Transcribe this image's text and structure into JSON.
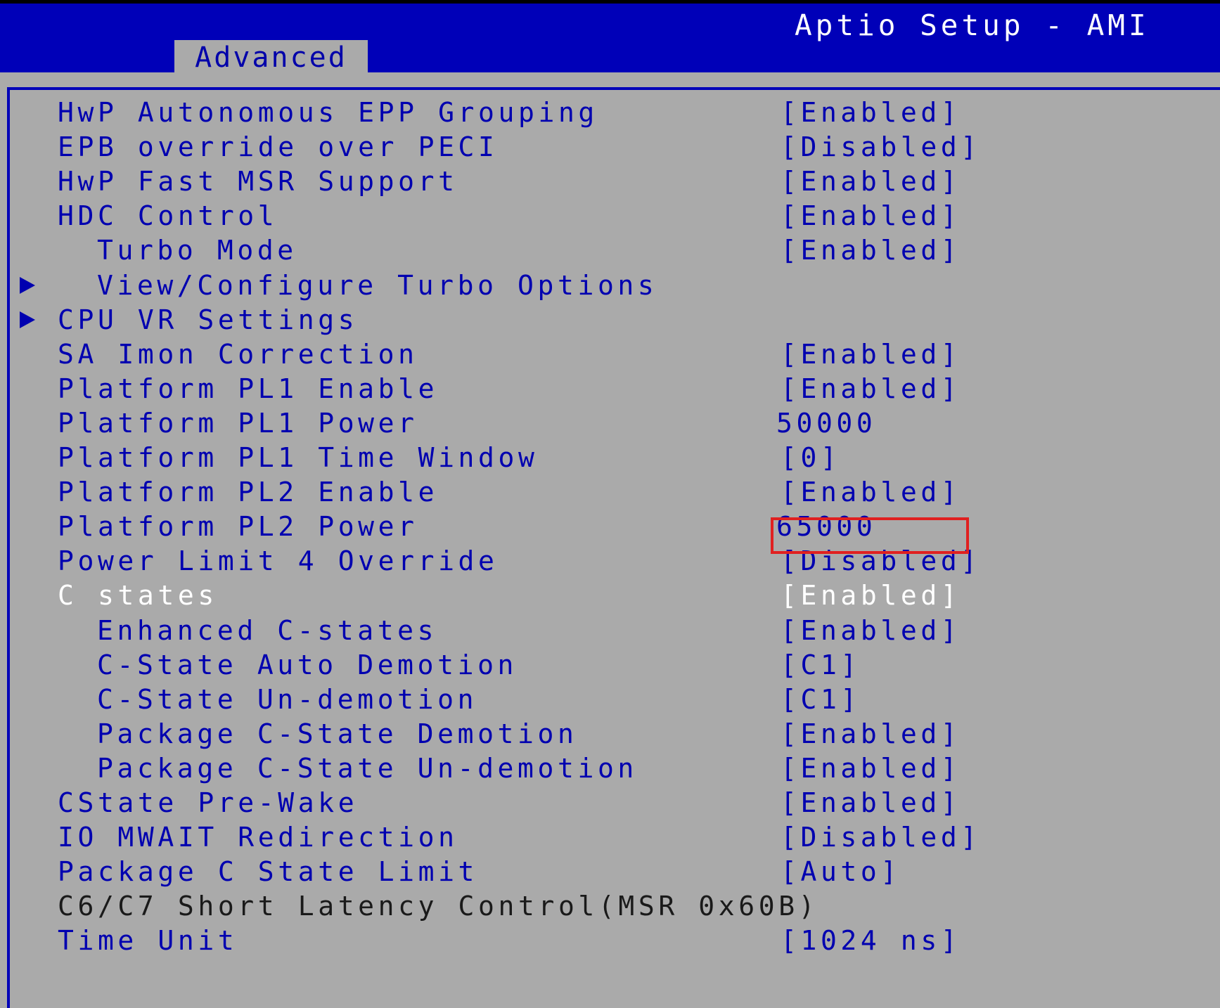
{
  "header": {
    "title": "Aptio Setup - AMI",
    "tab": "Advanced"
  },
  "settings": [
    {
      "label": "HwP Autonomous EPP Grouping",
      "value": "[Enabled]",
      "indent": 0,
      "submenu": false
    },
    {
      "label": "EPB override over PECI",
      "value": "[Disabled]",
      "indent": 0,
      "submenu": false
    },
    {
      "label": "HwP Fast MSR Support",
      "value": "[Enabled]",
      "indent": 0,
      "submenu": false
    },
    {
      "label": "HDC Control",
      "value": "[Enabled]",
      "indent": 0,
      "submenu": false
    },
    {
      "label": "Turbo Mode",
      "value": "[Enabled]",
      "indent": 1,
      "submenu": false
    },
    {
      "label": "View/Configure Turbo Options",
      "value": "",
      "indent": 1,
      "submenu": true
    },
    {
      "label": "CPU VR Settings",
      "value": "",
      "indent": 0,
      "submenu": true
    },
    {
      "label": "SA Imon Correction",
      "value": "[Enabled]",
      "indent": 0,
      "submenu": false
    },
    {
      "label": "Platform PL1 Enable",
      "value": "[Enabled]",
      "indent": 0,
      "submenu": false
    },
    {
      "label": "Platform PL1 Power",
      "value": "50000",
      "indent": 0,
      "submenu": false
    },
    {
      "label": "Platform PL1 Time Window",
      "value": "[0]",
      "indent": 0,
      "submenu": false
    },
    {
      "label": "Platform PL2 Enable",
      "value": "[Enabled]",
      "indent": 0,
      "submenu": false
    },
    {
      "label": "Platform PL2 Power",
      "value": "65000",
      "indent": 0,
      "submenu": false
    },
    {
      "label": "Power Limit 4 Override",
      "value": "[Disabled]",
      "indent": 0,
      "submenu": false
    },
    {
      "label": "C states",
      "value": "[Enabled]",
      "indent": 0,
      "submenu": false,
      "selected": true
    },
    {
      "label": "Enhanced C-states",
      "value": "[Enabled]",
      "indent": 1,
      "submenu": false
    },
    {
      "label": "C-State Auto Demotion",
      "value": "[C1]",
      "indent": 1,
      "submenu": false
    },
    {
      "label": "C-State Un-demotion",
      "value": "[C1]",
      "indent": 1,
      "submenu": false
    },
    {
      "label": "Package C-State Demotion",
      "value": "[Enabled]",
      "indent": 1,
      "submenu": false
    },
    {
      "label": "Package C-State Un-demotion",
      "value": "[Enabled]",
      "indent": 1,
      "submenu": false
    },
    {
      "label": "CState Pre-Wake",
      "value": "[Enabled]",
      "indent": 0,
      "submenu": false
    },
    {
      "label": "IO MWAIT Redirection",
      "value": "[Disabled]",
      "indent": 0,
      "submenu": false
    },
    {
      "label": "Package C State Limit",
      "value": "[Auto]",
      "indent": 0,
      "submenu": false
    },
    {
      "label": "C6/C7 Short Latency Control(MSR 0x60B)",
      "value": "",
      "indent": 0,
      "submenu": false,
      "static": true
    },
    {
      "label": "Time Unit",
      "value": "[1024 ns]",
      "indent": 0,
      "submenu": false
    }
  ],
  "colors": {
    "header_blue": "#0000b8",
    "panel_gray": "#aaaaaa",
    "item_text": "#0000b0",
    "selected_text": "#ffffff",
    "highlight_border": "#e02020"
  }
}
